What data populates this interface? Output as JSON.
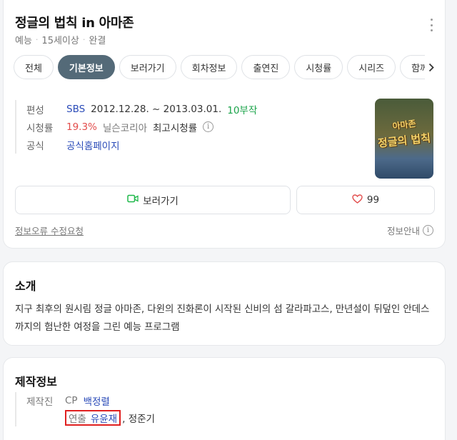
{
  "header": {
    "title": "정글의 법칙 in 아마존",
    "genre": "예능",
    "rating": "15세이상",
    "status": "완결"
  },
  "tabs": [
    "전체",
    "기본정보",
    "보러가기",
    "회차정보",
    "출연진",
    "시청률",
    "시리즈",
    "함께 볼"
  ],
  "active_tab": "기본정보",
  "info": {
    "broadcast_label": "편성",
    "channel": "SBS",
    "period": "2012.12.28. ~ 2013.03.01.",
    "episodes": "10부작",
    "viewership_label": "시청률",
    "viewership_value": "19.3%",
    "viewership_source": "닐슨코리아",
    "viewership_note": "최고시청률",
    "official_label": "공식",
    "official_link": "공식홈페이지"
  },
  "poster": {
    "line1": "아마존",
    "line2": "정글의 법칙"
  },
  "actions": {
    "watch_label": "보러가기",
    "like_count": "99"
  },
  "footer": {
    "report_link": "정보오류 수정요청",
    "info_guide": "정보안내"
  },
  "intro": {
    "title": "소개",
    "text": "지구 최후의 원시림 정글 아마존, 다윈의 진화론이 시작된 신비의 섬 갈라파고스, 만년설이 뒤덮인 안데스까지의 험난한 여정을 그린 예능 프로그램"
  },
  "production": {
    "title": "제작정보",
    "label": "제작진",
    "cp_role": "CP",
    "cp_name": "백정렬",
    "director_role": "연출",
    "director_name": "유윤재",
    "director_other": ", 정준기"
  },
  "colors": {
    "active_tab": "#546a78",
    "link_blue": "#2a4bb8",
    "episodes_green": "#1aa34a",
    "rating_red": "#e24c4b",
    "highlight_border": "#e02020"
  }
}
